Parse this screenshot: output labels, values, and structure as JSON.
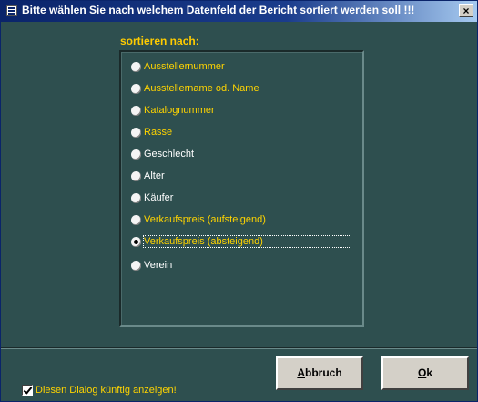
{
  "window": {
    "title": "Bitte wählen Sie nach welchem Datenfeld der Bericht sortiert werden soll !!!",
    "close_label": "×",
    "title_icon": "form-icon"
  },
  "group": {
    "label": "sortieren nach:",
    "selected_index": 8,
    "options": [
      {
        "label": "Ausstellernummer",
        "color": "#ffd400"
      },
      {
        "label": "Ausstellername od. Name",
        "color": "#ffd400"
      },
      {
        "label": "Katalognummer",
        "color": "#ffd400"
      },
      {
        "label": "Rasse",
        "color": "#ffd400"
      },
      {
        "label": "Geschlecht",
        "color": "#ffffff"
      },
      {
        "label": "Alter",
        "color": "#ffffff"
      },
      {
        "label": "Käufer",
        "color": "#ffffff"
      },
      {
        "label": "Verkaufspreis (aufsteigend)",
        "color": "#ffd400"
      },
      {
        "label": "Verkaufspreis (absteigend)",
        "color": "#ffd400"
      },
      {
        "label": "Verein",
        "color": "#ffffff"
      }
    ]
  },
  "footer": {
    "checkbox_label": "Diesen Dialog künftig anzeigen!",
    "checkbox_checked": true,
    "cancel_first": "A",
    "cancel_rest": "bbruch",
    "ok_first": "O",
    "ok_rest": "k"
  },
  "colors": {
    "background": "#2e4f4f",
    "accent_yellow": "#ffd400",
    "title_bar": "#0a246a"
  }
}
